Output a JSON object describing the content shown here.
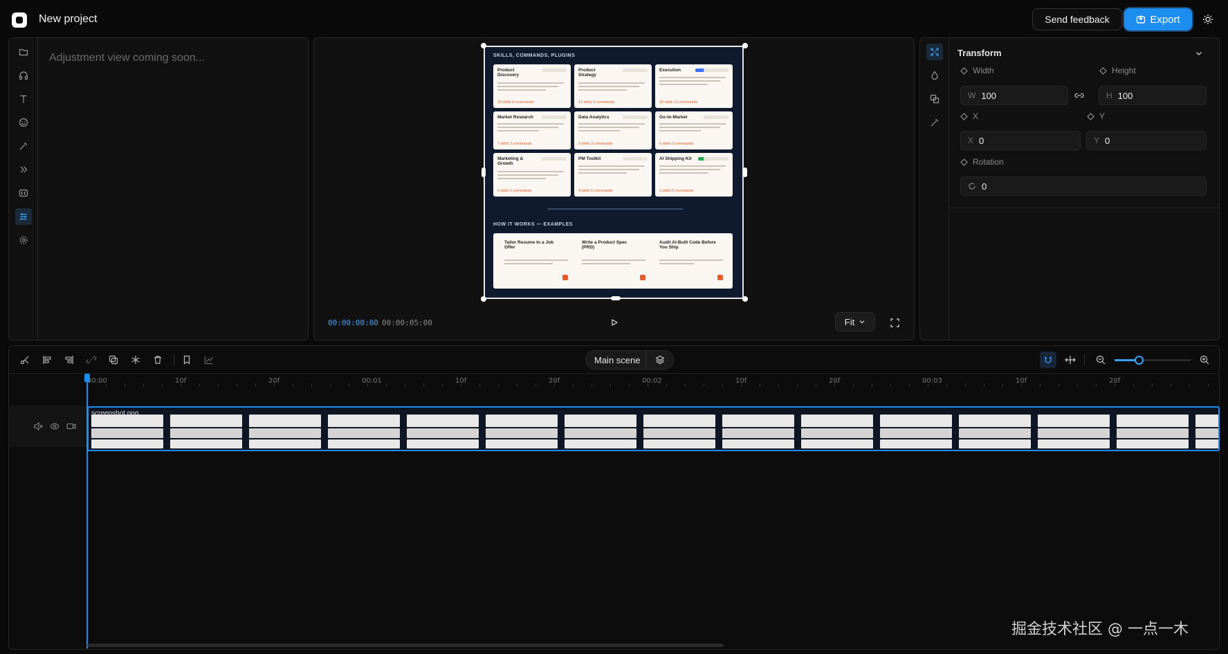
{
  "app": {
    "project_title": "New project",
    "feedback_label": "Send feedback",
    "export_label": "Export"
  },
  "left_panel": {
    "message": "Adjustment view coming soon...",
    "rail_icons": [
      "folder-icon",
      "headphones-icon",
      "text-icon",
      "smiley-icon",
      "magic-wand-icon",
      "chevrons-right-icon",
      "captions-icon",
      "sliders-icon",
      "settings-icon"
    ],
    "active_icon": "sliders-icon"
  },
  "preview": {
    "time_current": "00:00:00:00",
    "time_separator": "/",
    "time_total": "00:00:05:00",
    "fit_label": "Fit",
    "canvas": {
      "section1_title": "SKILLS, COMMANDS, PLUGINS",
      "cards": [
        {
          "title": "Product Discovery",
          "footer": "13 skills  5 commands"
        },
        {
          "title": "Product Strategy",
          "footer": "12 skills  5 commands"
        },
        {
          "title": "Execution",
          "footer": "16 skills  11 commands"
        },
        {
          "title": "Market Research",
          "footer": "7 skills  3 commands"
        },
        {
          "title": "Data Analytics",
          "footer": "3 skills  3 commands"
        },
        {
          "title": "Go-to-Market",
          "footer": "6 skills  3 commands"
        },
        {
          "title": "Marketing & Growth",
          "footer": "5 skills  2 commands"
        },
        {
          "title": "PM Toolkit",
          "footer": "4 skills  5 commands"
        },
        {
          "title": "AI Shipping Kit",
          "footer": "2 skills  5 commands"
        }
      ],
      "section2_title": "HOW IT WORKS — EXAMPLES",
      "examples": [
        {
          "title": "Tailor Resume to a Job Offer"
        },
        {
          "title": "Write a Product Spec (PRD)"
        },
        {
          "title": "Audit AI-Built Code Before You Ship"
        }
      ]
    }
  },
  "properties": {
    "section_title": "Transform",
    "width_label": "Width",
    "height_label": "Height",
    "width_prefix": "W",
    "width_value": "100",
    "height_prefix": "H",
    "height_value": "100",
    "x_label": "X",
    "y_label": "Y",
    "x_prefix": "X",
    "x_value": "0",
    "y_prefix": "Y",
    "y_value": "0",
    "rotation_label": "Rotation",
    "rotation_value": "0",
    "rail_icons": [
      "fit-expand-icon",
      "droplet-icon",
      "shapes-icon",
      "magic-wand-icon"
    ]
  },
  "timeline": {
    "scene_label": "Main scene",
    "zoom_level": 0.32,
    "ruler_labels": [
      "00:00",
      "10f",
      "20f",
      "00:01",
      "10f",
      "20f",
      "00:02",
      "10f",
      "20f",
      "00:03",
      "10f",
      "20f"
    ],
    "clip_label": "screenshot.png",
    "thumbnail_count": 15
  },
  "watermark": "掘金技术社区 @ 一点一木"
}
